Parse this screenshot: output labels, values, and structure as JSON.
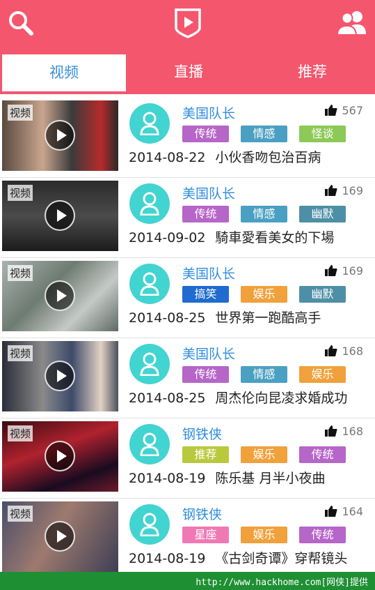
{
  "header": {
    "search_icon": "search-icon",
    "logo_icon": "play-shield-icon",
    "users_icon": "users-icon",
    "accent_color": "#f4566d"
  },
  "tabs": [
    {
      "label": "视频",
      "active": true
    },
    {
      "label": "直播",
      "active": false
    },
    {
      "label": "推荐",
      "active": false
    }
  ],
  "videos": [
    {
      "badge": "视频",
      "author": "美国队长",
      "likes": "567",
      "tags": [
        {
          "label": "传统",
          "color": "#b665c8"
        },
        {
          "label": "情感",
          "color": "#4aa0c2"
        },
        {
          "label": "怪谈",
          "color": "#8cc957"
        }
      ],
      "date": "2014-08-22",
      "title": "小伙香吻包治百病"
    },
    {
      "badge": "视频",
      "author": "美国队长",
      "likes": "169",
      "tags": [
        {
          "label": "传统",
          "color": "#b665c8"
        },
        {
          "label": "情感",
          "color": "#4aa0c2"
        },
        {
          "label": "幽默",
          "color": "#4d8fa6"
        }
      ],
      "date": "2014-09-02",
      "title": "騎車愛看美女的下場"
    },
    {
      "badge": "视频",
      "author": "美国队长",
      "likes": "169",
      "tags": [
        {
          "label": "搞笑",
          "color": "#1f6bcf"
        },
        {
          "label": "娱乐",
          "color": "#f0a13b"
        },
        {
          "label": "幽默",
          "color": "#4d8fa6"
        }
      ],
      "date": "2014-08-25",
      "title": "世界第一跑酷高手"
    },
    {
      "badge": "视频",
      "author": "美国队长",
      "likes": "168",
      "tags": [
        {
          "label": "传统",
          "color": "#b665c8"
        },
        {
          "label": "情感",
          "color": "#4aa0c2"
        },
        {
          "label": "娱乐",
          "color": "#f0a13b"
        }
      ],
      "date": "2014-08-25",
      "title": "周杰伦向昆凌求婚成功"
    },
    {
      "badge": "视频",
      "author": "钢铁侠",
      "likes": "168",
      "tags": [
        {
          "label": "推荐",
          "color": "#b9c93d"
        },
        {
          "label": "娱乐",
          "color": "#f0a13b"
        },
        {
          "label": "传统",
          "color": "#b665c8"
        }
      ],
      "date": "2014-08-19",
      "title": "陈乐基 月半小夜曲"
    },
    {
      "badge": "视频",
      "author": "钢铁侠",
      "likes": "164",
      "tags": [
        {
          "label": "星座",
          "color": "#ef79b4"
        },
        {
          "label": "娱乐",
          "color": "#f0a13b"
        },
        {
          "label": "传统",
          "color": "#b665c8"
        }
      ],
      "date": "2014-08-19",
      "title": "《古剑奇谭》穿帮镜头"
    }
  ],
  "watermark": "http://www.hackhome.com[网侠]提供"
}
